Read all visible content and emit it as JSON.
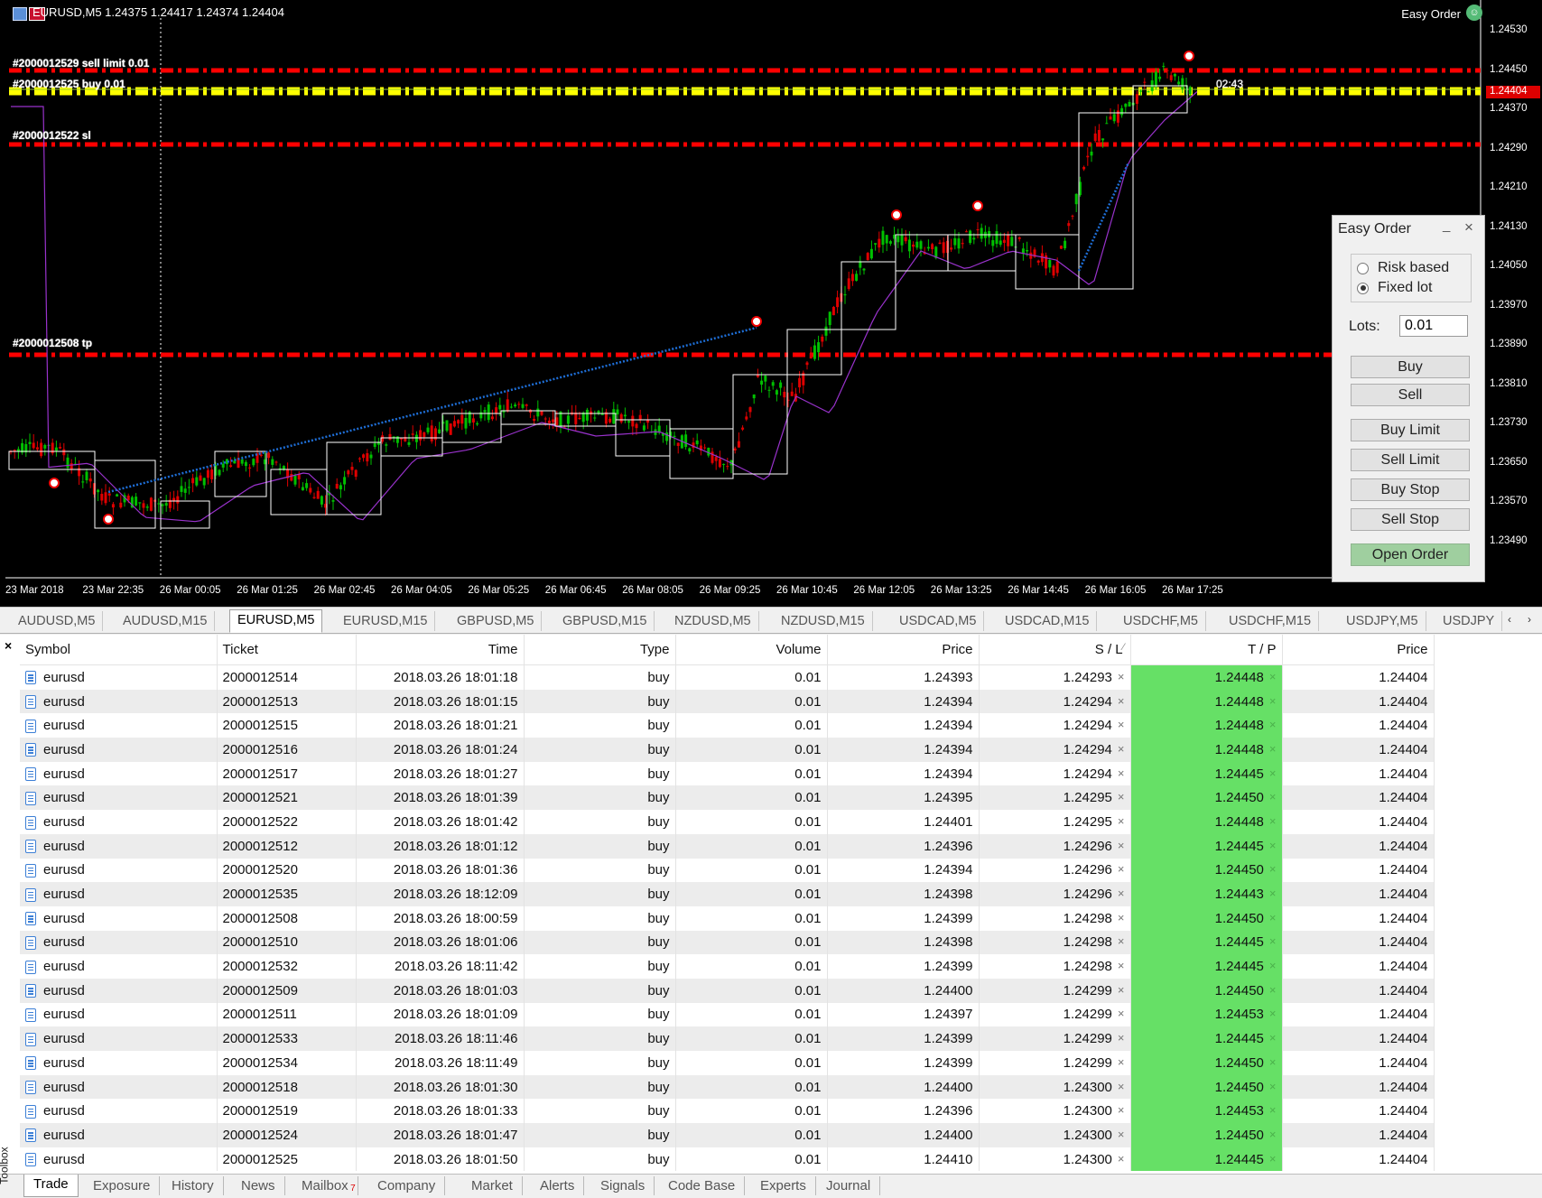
{
  "chart": {
    "title": "EURUSD,M5  1.24375 1.24417 1.24374 1.24404",
    "ea_name": "Easy Order",
    "ea_icon": "smiley-hat-icon",
    "price_levels": [
      "1.24530",
      "1.24450",
      "1.24370",
      "1.24290",
      "1.24210",
      "1.24130",
      "1.24050",
      "1.23970",
      "1.23890",
      "1.23810",
      "1.23730",
      "1.23650",
      "1.23570",
      "1.23490"
    ],
    "current_price": "1.24404",
    "time_labels": [
      "23 Mar 2018",
      "23 Mar 22:35",
      "26 Mar 00:05",
      "26 Mar 01:25",
      "26 Mar 02:45",
      "26 Mar 04:05",
      "26 Mar 05:25",
      "26 Mar 06:45",
      "26 Mar 08:05",
      "26 Mar 09:25",
      "26 Mar 10:45",
      "26 Mar 12:05",
      "26 Mar 13:25",
      "26 Mar 14:45",
      "26 Mar 16:05",
      "26 Mar 17:25"
    ],
    "countdown": "02:43",
    "order_lines": [
      {
        "label": "#2000012529 sell limit 0.01",
        "price": "1.24450",
        "color": "#ff0000"
      },
      {
        "label": "#2000012525 buy 0.01",
        "price": "1.24410",
        "color": "#ffff00"
      },
      {
        "label": "#2000012522 sl",
        "price": "1.24300",
        "color": "#ff0000"
      },
      {
        "label": "#2000012508 tp",
        "price": "1.23880",
        "color": "#ff0000"
      }
    ]
  },
  "easy_order": {
    "title": "Easy Order",
    "minimize": "_",
    "close": "×",
    "risk_based": "Risk based",
    "fixed_lot": "Fixed lot",
    "lots_label": "Lots:",
    "lots_value": "0.01",
    "buttons": [
      "Buy",
      "Sell",
      "Buy Limit",
      "Sell Limit",
      "Buy Stop",
      "Sell Stop",
      "Open Order"
    ],
    "accent_open": "#9fcf9f"
  },
  "symbol_tabs": [
    "AUDUSD,M5",
    "AUDUSD,M15",
    "EURUSD,M5",
    "EURUSD,M15",
    "GBPUSD,M5",
    "GBPUSD,M15",
    "NZDUSD,M5",
    "NZDUSD,M15",
    "USDCAD,M5",
    "USDCAD,M15",
    "USDCHF,M5",
    "USDCHF,M15",
    "USDJPY,M5",
    "USDJPY"
  ],
  "active_symbol_tab": 2,
  "table": {
    "headers": [
      "Symbol",
      "Ticket",
      "Time",
      "Type",
      "Volume",
      "Price",
      "S / L",
      "T / P",
      "Price"
    ],
    "rows": [
      [
        "eurusd",
        "2000012514",
        "2018.03.26 18:01:18",
        "buy",
        "0.01",
        "1.24393",
        "1.24293",
        "1.24448",
        "1.24404"
      ],
      [
        "eurusd",
        "2000012513",
        "2018.03.26 18:01:15",
        "buy",
        "0.01",
        "1.24394",
        "1.24294",
        "1.24448",
        "1.24404"
      ],
      [
        "eurusd",
        "2000012515",
        "2018.03.26 18:01:21",
        "buy",
        "0.01",
        "1.24394",
        "1.24294",
        "1.24448",
        "1.24404"
      ],
      [
        "eurusd",
        "2000012516",
        "2018.03.26 18:01:24",
        "buy",
        "0.01",
        "1.24394",
        "1.24294",
        "1.24448",
        "1.24404"
      ],
      [
        "eurusd",
        "2000012517",
        "2018.03.26 18:01:27",
        "buy",
        "0.01",
        "1.24394",
        "1.24294",
        "1.24445",
        "1.24404"
      ],
      [
        "eurusd",
        "2000012521",
        "2018.03.26 18:01:39",
        "buy",
        "0.01",
        "1.24395",
        "1.24295",
        "1.24450",
        "1.24404"
      ],
      [
        "eurusd",
        "2000012522",
        "2018.03.26 18:01:42",
        "buy",
        "0.01",
        "1.24401",
        "1.24295",
        "1.24448",
        "1.24404"
      ],
      [
        "eurusd",
        "2000012512",
        "2018.03.26 18:01:12",
        "buy",
        "0.01",
        "1.24396",
        "1.24296",
        "1.24445",
        "1.24404"
      ],
      [
        "eurusd",
        "2000012520",
        "2018.03.26 18:01:36",
        "buy",
        "0.01",
        "1.24394",
        "1.24296",
        "1.24450",
        "1.24404"
      ],
      [
        "eurusd",
        "2000012535",
        "2018.03.26 18:12:09",
        "buy",
        "0.01",
        "1.24398",
        "1.24296",
        "1.24443",
        "1.24404"
      ],
      [
        "eurusd",
        "2000012508",
        "2018.03.26 18:00:59",
        "buy",
        "0.01",
        "1.24399",
        "1.24298",
        "1.24450",
        "1.24404"
      ],
      [
        "eurusd",
        "2000012510",
        "2018.03.26 18:01:06",
        "buy",
        "0.01",
        "1.24398",
        "1.24298",
        "1.24445",
        "1.24404"
      ],
      [
        "eurusd",
        "2000012532",
        "2018.03.26 18:11:42",
        "buy",
        "0.01",
        "1.24399",
        "1.24298",
        "1.24445",
        "1.24404"
      ],
      [
        "eurusd",
        "2000012509",
        "2018.03.26 18:01:03",
        "buy",
        "0.01",
        "1.24400",
        "1.24299",
        "1.24450",
        "1.24404"
      ],
      [
        "eurusd",
        "2000012511",
        "2018.03.26 18:01:09",
        "buy",
        "0.01",
        "1.24397",
        "1.24299",
        "1.24453",
        "1.24404"
      ],
      [
        "eurusd",
        "2000012533",
        "2018.03.26 18:11:46",
        "buy",
        "0.01",
        "1.24399",
        "1.24299",
        "1.24445",
        "1.24404"
      ],
      [
        "eurusd",
        "2000012534",
        "2018.03.26 18:11:49",
        "buy",
        "0.01",
        "1.24399",
        "1.24299",
        "1.24450",
        "1.24404"
      ],
      [
        "eurusd",
        "2000012518",
        "2018.03.26 18:01:30",
        "buy",
        "0.01",
        "1.24400",
        "1.24300",
        "1.24450",
        "1.24404"
      ],
      [
        "eurusd",
        "2000012519",
        "2018.03.26 18:01:33",
        "buy",
        "0.01",
        "1.24396",
        "1.24300",
        "1.24453",
        "1.24404"
      ],
      [
        "eurusd",
        "2000012524",
        "2018.03.26 18:01:47",
        "buy",
        "0.01",
        "1.24400",
        "1.24300",
        "1.24450",
        "1.24404"
      ],
      [
        "eurusd",
        "2000012525",
        "2018.03.26 18:01:50",
        "buy",
        "0.01",
        "1.24410",
        "1.24300",
        "1.24445",
        "1.24404"
      ]
    ],
    "tp_highlight_color": "#66e066"
  },
  "bottom_tabs": [
    "Trade",
    "Exposure",
    "History",
    "News",
    "Mailbox",
    "Company",
    "Market",
    "Alerts",
    "Signals",
    "Code Base",
    "Experts",
    "Journal"
  ],
  "mailbox_badge": "7",
  "toolbox_label": "Toolbox",
  "terminal_close": "×",
  "tab_arrows": [
    "‹",
    "›"
  ]
}
